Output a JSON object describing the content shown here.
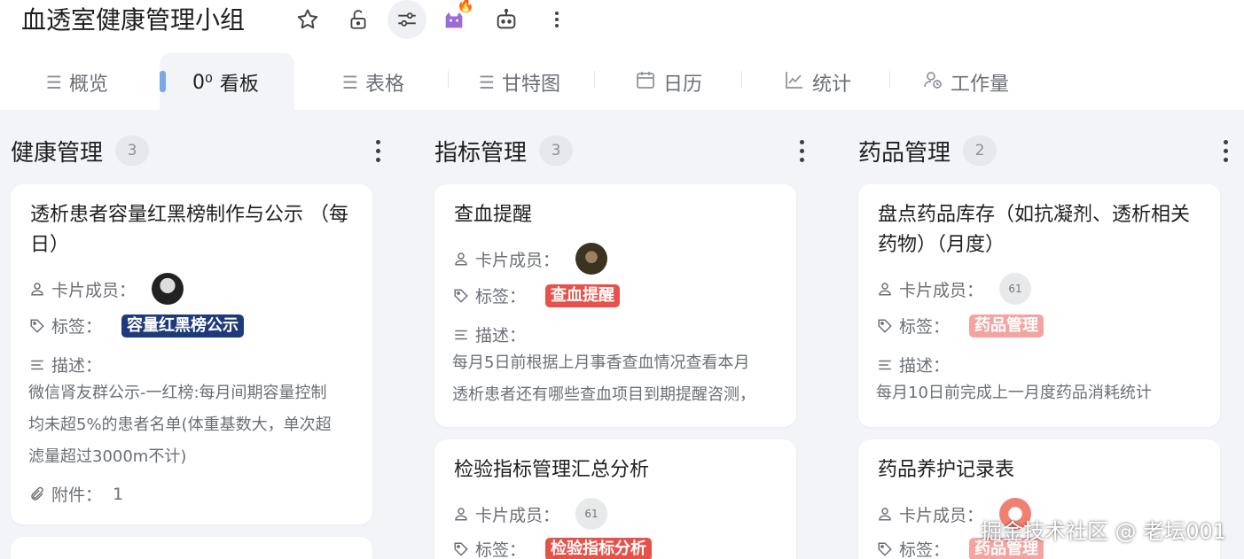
{
  "header": {
    "title": "血透室健康管理小组",
    "icons": [
      "star-icon",
      "unlock-icon",
      "sliders-icon",
      "cat-icon",
      "fire-icon",
      "robot-icon",
      "more-vertical-icon"
    ]
  },
  "tabs": [
    {
      "label": "概览",
      "icon": "list-icon"
    },
    {
      "label": "看板",
      "icon": "board-icon",
      "active": true,
      "glyph": "0⁰"
    },
    {
      "label": "表格",
      "icon": "list-icon"
    },
    {
      "label": "甘特图",
      "icon": "gantt-icon"
    },
    {
      "label": "日历",
      "icon": "calendar-icon"
    },
    {
      "label": "统计",
      "icon": "chart-icon"
    },
    {
      "label": "工作量",
      "icon": "workload-icon"
    }
  ],
  "columns": [
    {
      "title": "健康管理",
      "count": "3",
      "cards": [
        {
          "title_lines": [
            "透析患者容量红黑榜制作与公示 （每",
            "日）"
          ],
          "member_label": "卡片成员：",
          "tag_label": "标签：",
          "tag": "容量红黑榜公示",
          "tag_color": "#1f3a7a",
          "desc_label": "描述：",
          "desc_lines": [
            "微信肾友群公示-一红榜:每月间期容量控制",
            "均未超5%的患者名单(体重基数大，单次超",
            "滤量超过3000m不计)"
          ],
          "attach_label": "附件：",
          "attach_count": "1"
        }
      ]
    },
    {
      "title": "指标管理",
      "count": "3",
      "cards": [
        {
          "title_lines": [
            "查血提醒"
          ],
          "member_label": "卡片成员：",
          "tag_label": "标签：",
          "tag": "查血提醒",
          "tag_color": "#e8504a",
          "desc_label": "描述：",
          "desc_lines": [
            "每月5日前根据上月事香查血情况查看本月",
            "透析患者还有哪些查血项目到期提醒咨测，"
          ]
        },
        {
          "title_lines": [
            "检验指标管理汇总分析"
          ],
          "member_label": "卡片成员：",
          "member_text": "61",
          "tag_label": "标签：",
          "tag": "检验指标分析",
          "tag_color": "#e8504a"
        }
      ]
    },
    {
      "title": "药品管理",
      "count": "2",
      "cards": [
        {
          "title_lines": [
            "盘点药品库存（如抗凝剂、透析相关",
            "药物）（月度）"
          ],
          "member_label": "卡片成员：",
          "member_text": "61",
          "tag_label": "标签：",
          "tag": "药品管理",
          "tag_color": "#f4a3a0",
          "desc_label": "描述：",
          "desc_lines": [
            "每月10日前完成上一月度药品消耗统计"
          ]
        },
        {
          "title_lines": [
            "药品养护记录表"
          ],
          "member_label": "卡片成员：",
          "tag_label": "标签：",
          "tag": "药品管理",
          "tag_color": "#f4a3a0"
        }
      ]
    }
  ],
  "watermark": "掘金技术社区 @ 老坛001"
}
